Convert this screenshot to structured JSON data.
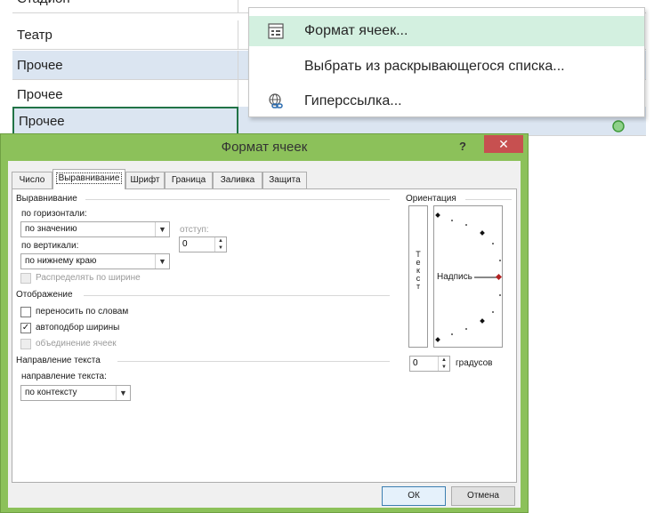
{
  "sheet": {
    "partial_row": "Стадион",
    "rows": [
      "Театр",
      "Прочее",
      "Прочее",
      "Прочее"
    ]
  },
  "context_menu": {
    "items": [
      {
        "label": "Формат ячеек...",
        "icon": "format-cells-icon"
      },
      {
        "label": "Выбрать из раскрывающегося списка...",
        "icon": ""
      },
      {
        "label": "Гиперссылка...",
        "icon": "hyperlink-icon"
      }
    ]
  },
  "dialog": {
    "title": "Формат ячеек",
    "help": "?",
    "close": "✕",
    "tabs": [
      "Число",
      "Выравнивание",
      "Шрифт",
      "Граница",
      "Заливка",
      "Защита"
    ],
    "alignment": {
      "section": "Выравнивание",
      "horizontal_label": "по горизонтали:",
      "horizontal_value": "по значению",
      "indent_label": "отступ:",
      "indent_value": "0",
      "vertical_label": "по вертикали:",
      "vertical_value": "по нижнему краю",
      "distribute_label": "Распределять по ширине"
    },
    "display": {
      "section": "Отображение",
      "wrap_label": "переносить по словам",
      "shrink_label": "автоподбор ширины",
      "merge_label": "объединение ячеек"
    },
    "direction": {
      "section": "Направление текста",
      "label": "направление текста:",
      "value": "по контексту"
    },
    "orientation": {
      "section": "Ориентация",
      "vertical_text": [
        "Т",
        "е",
        "к",
        "с",
        "т"
      ],
      "dial_label": "Надпись",
      "degrees_value": "0",
      "degrees_label": "градусов"
    },
    "buttons": {
      "ok": "ОК",
      "cancel": "Отмена"
    }
  },
  "colors": {
    "row_highlight": "#dbe5f1",
    "menu_highlight": "#d3f0e0",
    "title_bar": "#8cc15a",
    "close_button": "#c75050",
    "selection_border": "#217346"
  }
}
